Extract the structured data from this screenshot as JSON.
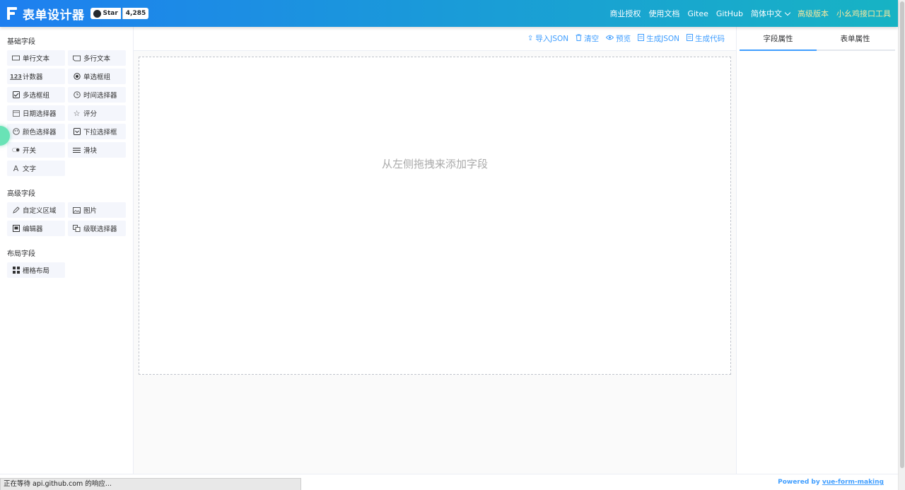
{
  "header": {
    "title": "表单设计器",
    "github_star_label": "Star",
    "github_star_count": "4,285",
    "nav": {
      "license": "商业授权",
      "docs": "使用文档",
      "gitee": "Gitee",
      "github": "GitHub",
      "language": "简体中文",
      "pro": "高级版本",
      "tool": "小幺鸡接口工具"
    }
  },
  "left_panel": {
    "basic": {
      "title": "基础字段",
      "items": [
        "单行文本",
        "多行文本",
        "计数器",
        "单选框组",
        "多选框组",
        "时间选择器",
        "日期选择器",
        "评分",
        "颜色选择器",
        "下拉选择框",
        "开关",
        "滑块",
        "文字"
      ]
    },
    "advanced": {
      "title": "高级字段",
      "items": [
        "自定义区域",
        "图片",
        "编辑器",
        "级联选择器"
      ]
    },
    "layout": {
      "title": "布局字段",
      "items": [
        "栅格布局"
      ]
    }
  },
  "toolbar": {
    "import_json": "导入JSON",
    "clear": "清空",
    "preview": "预览",
    "gen_json": "生成JSON",
    "gen_code": "生成代码"
  },
  "canvas": {
    "hint": "从左侧拖拽来添加字段"
  },
  "right_panel": {
    "tabs": [
      "字段属性",
      "表单属性"
    ],
    "active_tab": "字段属性"
  },
  "footer": {
    "status_text": "正在等待 api.github.com 的响应...",
    "powered_prefix": "Powered by",
    "powered_link": "vue-form-making"
  },
  "colors": {
    "accent": "#409eff",
    "header_start": "#1e7ff0",
    "header_end": "#17b3c4",
    "highlight_nav": "#f2e7a0"
  }
}
